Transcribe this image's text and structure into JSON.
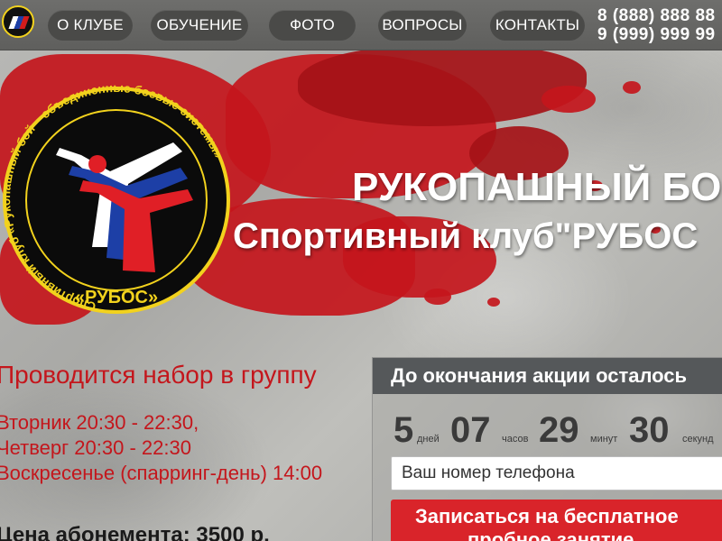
{
  "header": {
    "nav": [
      {
        "label": "О КЛУБЕ"
      },
      {
        "label": "ОБУЧЕНИЕ"
      },
      {
        "label": "ФОТО"
      },
      {
        "label": "ВОПРОСЫ"
      },
      {
        "label": "КОНТАКТЫ"
      }
    ],
    "phones": [
      "8 (888) 888 88",
      "9 (999) 999 99"
    ],
    "logo_icon": "club-logo-icon"
  },
  "emblem": {
    "ring_text": "Спортивный клуб «Рукопашный бой – объединенные боевые системы»",
    "name": "«РУБОС»",
    "icon": "club-emblem-icon"
  },
  "hero": {
    "title_line1": "РУКОПАШНЫЙ БОЙ",
    "title_line2": "Спортивный клуб\"РУБОС"
  },
  "recruitment": {
    "title": "Проводится набор в группу",
    "schedule": [
      "Вторник 20:30 - 22:30,",
      "Четверг 20:30 - 22:30",
      "Воскресенье (спарринг-день) 14:00"
    ],
    "price": "Цена абонемента: 3500 р."
  },
  "promo": {
    "header": "До окончания акции осталось",
    "countdown": {
      "days": {
        "value": "5",
        "label": "дней"
      },
      "hours": {
        "value": "07",
        "label": "часов"
      },
      "minutes": {
        "value": "29",
        "label": "минут"
      },
      "seconds": {
        "value": "30",
        "label": "секунд"
      }
    },
    "phone_placeholder": "Ваш номер телефона",
    "cta_line1": "Записаться на бесплатное",
    "cta_line2": "пробное занятие"
  },
  "colors": {
    "accent_red": "#c4161c",
    "header_gray": "#666664",
    "emblem_yellow": "#f2d21d"
  }
}
